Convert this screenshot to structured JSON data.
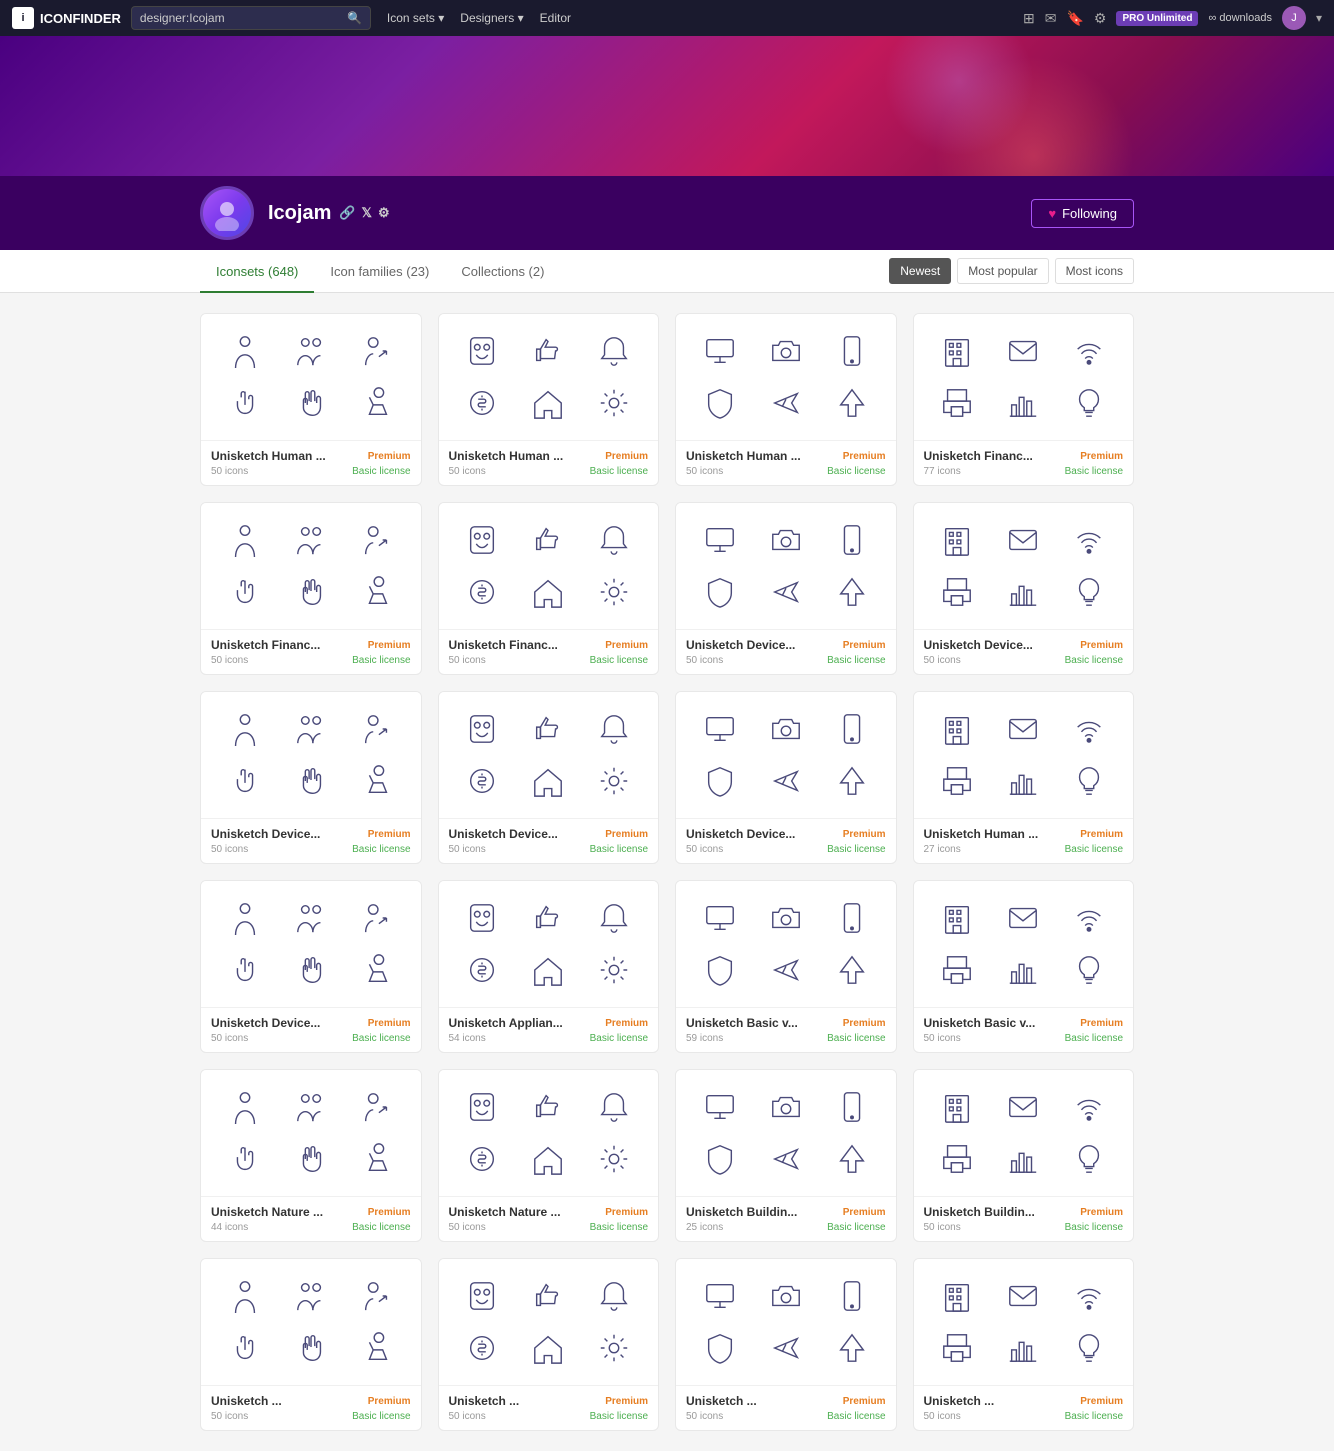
{
  "topNav": {
    "logo": "ICONFINDER",
    "logoShort": "i",
    "searchPlaceholder": "designer:Icojam",
    "searchValue": "designer:Icojam",
    "links": [
      {
        "label": "Icon sets",
        "hasDropdown": true
      },
      {
        "label": "Designers",
        "hasDropdown": true
      },
      {
        "label": "Editor",
        "hasDropdown": false
      }
    ],
    "proLabel": "PRO Unlimited",
    "proSub": "∞ downloads"
  },
  "profile": {
    "name": "Icojam",
    "followingLabel": "Following",
    "heartIcon": "♥"
  },
  "tabs": {
    "items": [
      {
        "label": "Iconsets (648)",
        "id": "iconsets",
        "active": true
      },
      {
        "label": "Icon families (23)",
        "id": "families",
        "active": false
      },
      {
        "label": "Collections (2)",
        "id": "collections",
        "active": false
      }
    ],
    "sort": [
      {
        "label": "Newest",
        "active": true
      },
      {
        "label": "Most popular",
        "active": false
      },
      {
        "label": "Most icons",
        "active": false
      }
    ]
  },
  "cards": [
    {
      "title": "Unisketch Human ...",
      "badge": "Premium",
      "icons": 50,
      "license": "Basic license"
    },
    {
      "title": "Unisketch Human ...",
      "badge": "Premium",
      "icons": 50,
      "license": "Basic license"
    },
    {
      "title": "Unisketch Human ...",
      "badge": "Premium",
      "icons": 50,
      "license": "Basic license"
    },
    {
      "title": "Unisketch Financ...",
      "badge": "Premium",
      "icons": 77,
      "license": "Basic license"
    },
    {
      "title": "Unisketch Financ...",
      "badge": "Premium",
      "icons": 50,
      "license": "Basic license"
    },
    {
      "title": "Unisketch Financ...",
      "badge": "Premium",
      "icons": 50,
      "license": "Basic license"
    },
    {
      "title": "Unisketch Device...",
      "badge": "Premium",
      "icons": 50,
      "license": "Basic license"
    },
    {
      "title": "Unisketch Device...",
      "badge": "Premium",
      "icons": 50,
      "license": "Basic license"
    },
    {
      "title": "Unisketch Device...",
      "badge": "Premium",
      "icons": 50,
      "license": "Basic license"
    },
    {
      "title": "Unisketch Device...",
      "badge": "Premium",
      "icons": 50,
      "license": "Basic license"
    },
    {
      "title": "Unisketch Device...",
      "badge": "Premium",
      "icons": 50,
      "license": "Basic license"
    },
    {
      "title": "Unisketch Human ...",
      "badge": "Premium",
      "icons": 27,
      "license": "Basic license"
    },
    {
      "title": "Unisketch Device...",
      "badge": "Premium",
      "icons": 50,
      "license": "Basic license"
    },
    {
      "title": "Unisketch Applian...",
      "badge": "Premium",
      "icons": 54,
      "license": "Basic license"
    },
    {
      "title": "Unisketch Basic v...",
      "badge": "Premium",
      "icons": 59,
      "license": "Basic license"
    },
    {
      "title": "Unisketch Basic v...",
      "badge": "Premium",
      "icons": 50,
      "license": "Basic license"
    },
    {
      "title": "Unisketch Nature ...",
      "badge": "Premium",
      "icons": 44,
      "license": "Basic license"
    },
    {
      "title": "Unisketch Nature ...",
      "badge": "Premium",
      "icons": 50,
      "license": "Basic license"
    },
    {
      "title": "Unisketch Buildin...",
      "badge": "Premium",
      "icons": 25,
      "license": "Basic license"
    },
    {
      "title": "Unisketch Buildin...",
      "badge": "Premium",
      "icons": 50,
      "license": "Basic license"
    },
    {
      "title": "Unisketch ...",
      "badge": "Premium",
      "icons": 50,
      "license": "Basic license"
    },
    {
      "title": "Unisketch ...",
      "badge": "Premium",
      "icons": 50,
      "license": "Basic license"
    },
    {
      "title": "Unisketch ...",
      "badge": "Premium",
      "icons": 50,
      "license": "Basic license"
    },
    {
      "title": "Unisketch ...",
      "badge": "Premium",
      "icons": 50,
      "license": "Basic license"
    }
  ],
  "iconSets": "Icon sets",
  "collections": "Collections"
}
